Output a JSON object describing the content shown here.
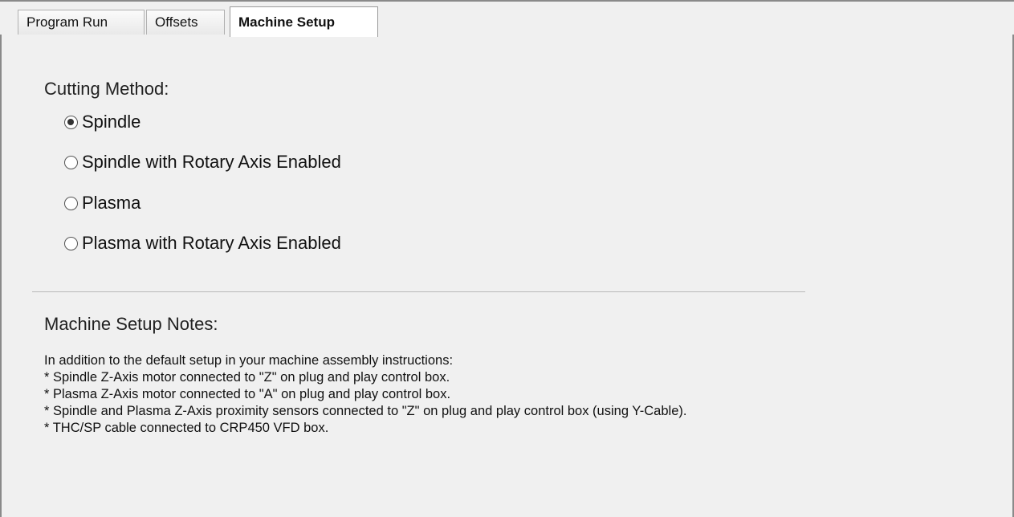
{
  "tabs": [
    {
      "label": "Program Run",
      "active": false
    },
    {
      "label": "Offsets",
      "active": false
    },
    {
      "label": "Machine Setup",
      "active": true
    }
  ],
  "cutting_method": {
    "title": "Cutting Method:",
    "selected": "Spindle",
    "options": [
      {
        "label": "Spindle",
        "checked": true
      },
      {
        "label": "Spindle with Rotary Axis Enabled",
        "checked": false
      },
      {
        "label": "Plasma",
        "checked": false
      },
      {
        "label": "Plasma with Rotary Axis Enabled",
        "checked": false
      }
    ]
  },
  "notes": {
    "title": "Machine Setup Notes:",
    "lines": [
      "In addition to the default setup in your machine assembly instructions:",
      "* Spindle Z-Axis motor connected to \"Z\" on plug and play control box.",
      "* Plasma Z-Axis motor connected to \"A\" on plug and play control box.",
      "* Spindle and Plasma Z-Axis proximity sensors connected to \"Z\" on plug and play control box (using Y-Cable).",
      "* THC/SP cable connected to CRP450 VFD box."
    ]
  }
}
